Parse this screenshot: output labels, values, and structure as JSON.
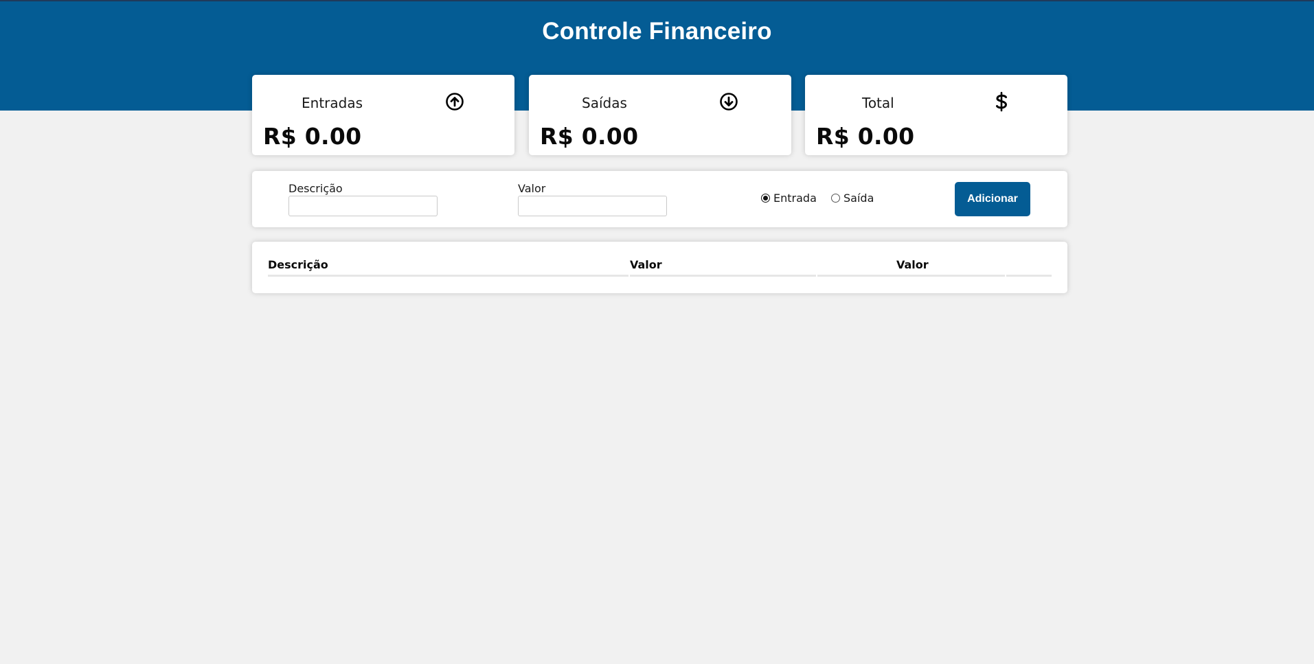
{
  "header": {
    "title": "Controle Financeiro"
  },
  "summary": [
    {
      "label": "Entradas",
      "icon": "arrow-up-circle-icon",
      "value": "R$ 0.00"
    },
    {
      "label": "Saídas",
      "icon": "arrow-down-circle-icon",
      "value": "R$ 0.00"
    },
    {
      "label": "Total",
      "icon": "dollar-icon",
      "value": "R$ 0.00"
    }
  ],
  "form": {
    "description_label": "Descrição",
    "description_value": "",
    "amount_label": "Valor",
    "amount_value": "",
    "type_options": [
      {
        "label": "Entrada",
        "checked": true
      },
      {
        "label": "Saída",
        "checked": false
      }
    ],
    "add_label": "Adicionar"
  },
  "table": {
    "headers": [
      "Descrição",
      "Valor",
      "Valor",
      ""
    ],
    "rows": []
  },
  "colors": {
    "primary": "#045c94",
    "background": "#f1f1f1",
    "card": "#ffffff"
  }
}
